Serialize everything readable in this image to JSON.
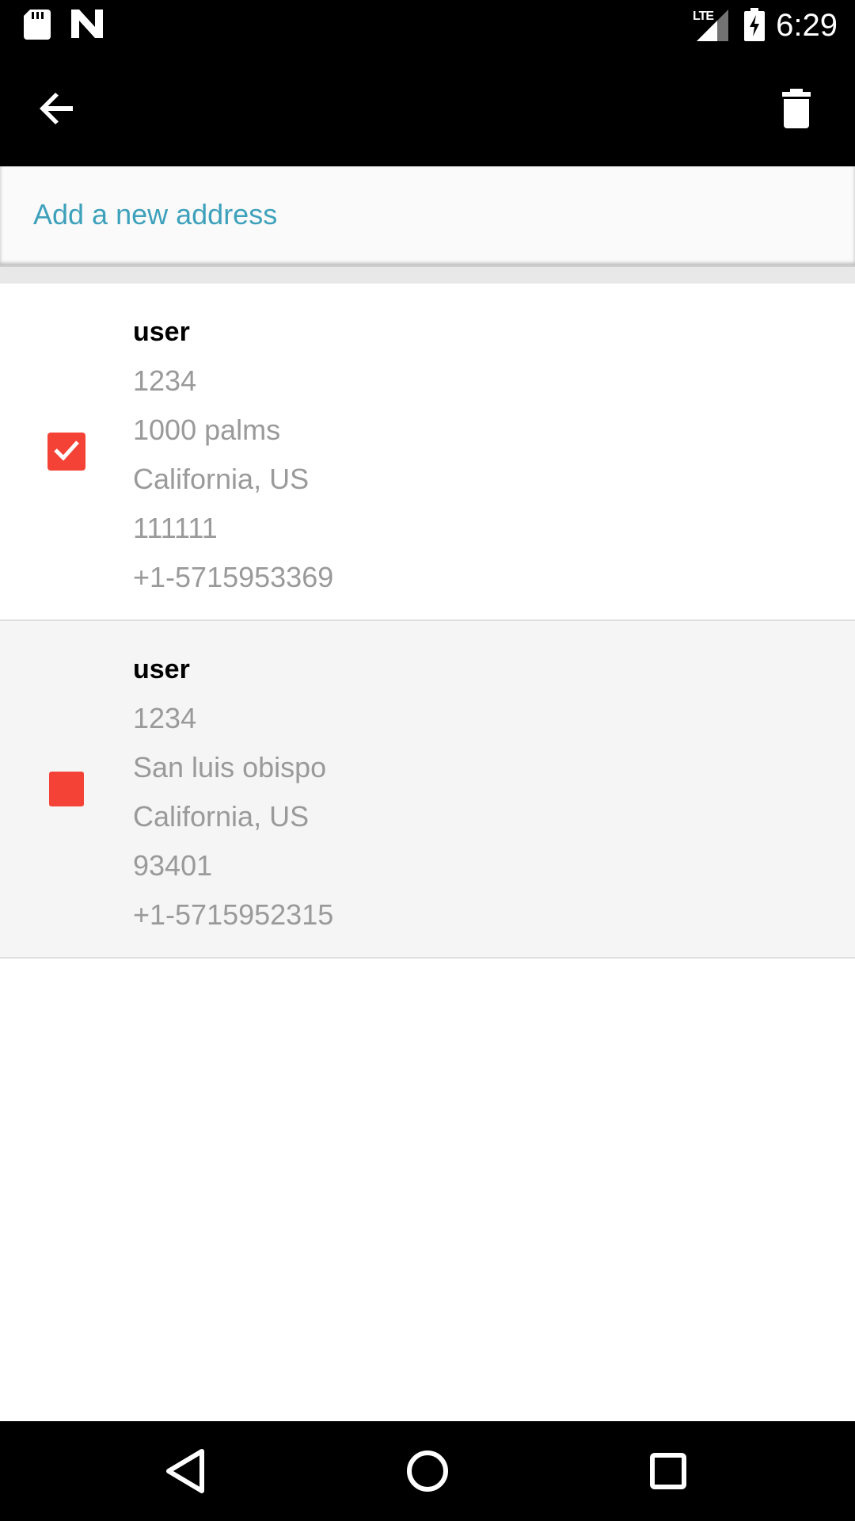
{
  "status_bar": {
    "time": "6:29",
    "network": "LTE",
    "icons": [
      "sd-card-icon",
      "n-icon",
      "signal-icon",
      "battery-charging-icon"
    ]
  },
  "toolbar": {
    "back_icon": "arrow-back-icon",
    "delete_icon": "trash-icon"
  },
  "add_address": {
    "label": "Add a new address",
    "color": "#3ea1bb"
  },
  "addresses": [
    {
      "checked": true,
      "name": "user",
      "lines": [
        "1234",
        "1000 palms",
        "California, US",
        "111111",
        "+1-5715953369"
      ]
    },
    {
      "checked": false,
      "name": "user",
      "lines": [
        "1234",
        "San luis obispo",
        "California, US",
        "93401",
        "+1-5715952315"
      ]
    }
  ],
  "colors": {
    "accent": "#f44336",
    "bar_background": "#000000"
  },
  "nav_bar": {
    "icons": [
      "nav-back-icon",
      "nav-home-icon",
      "nav-recents-icon"
    ]
  }
}
